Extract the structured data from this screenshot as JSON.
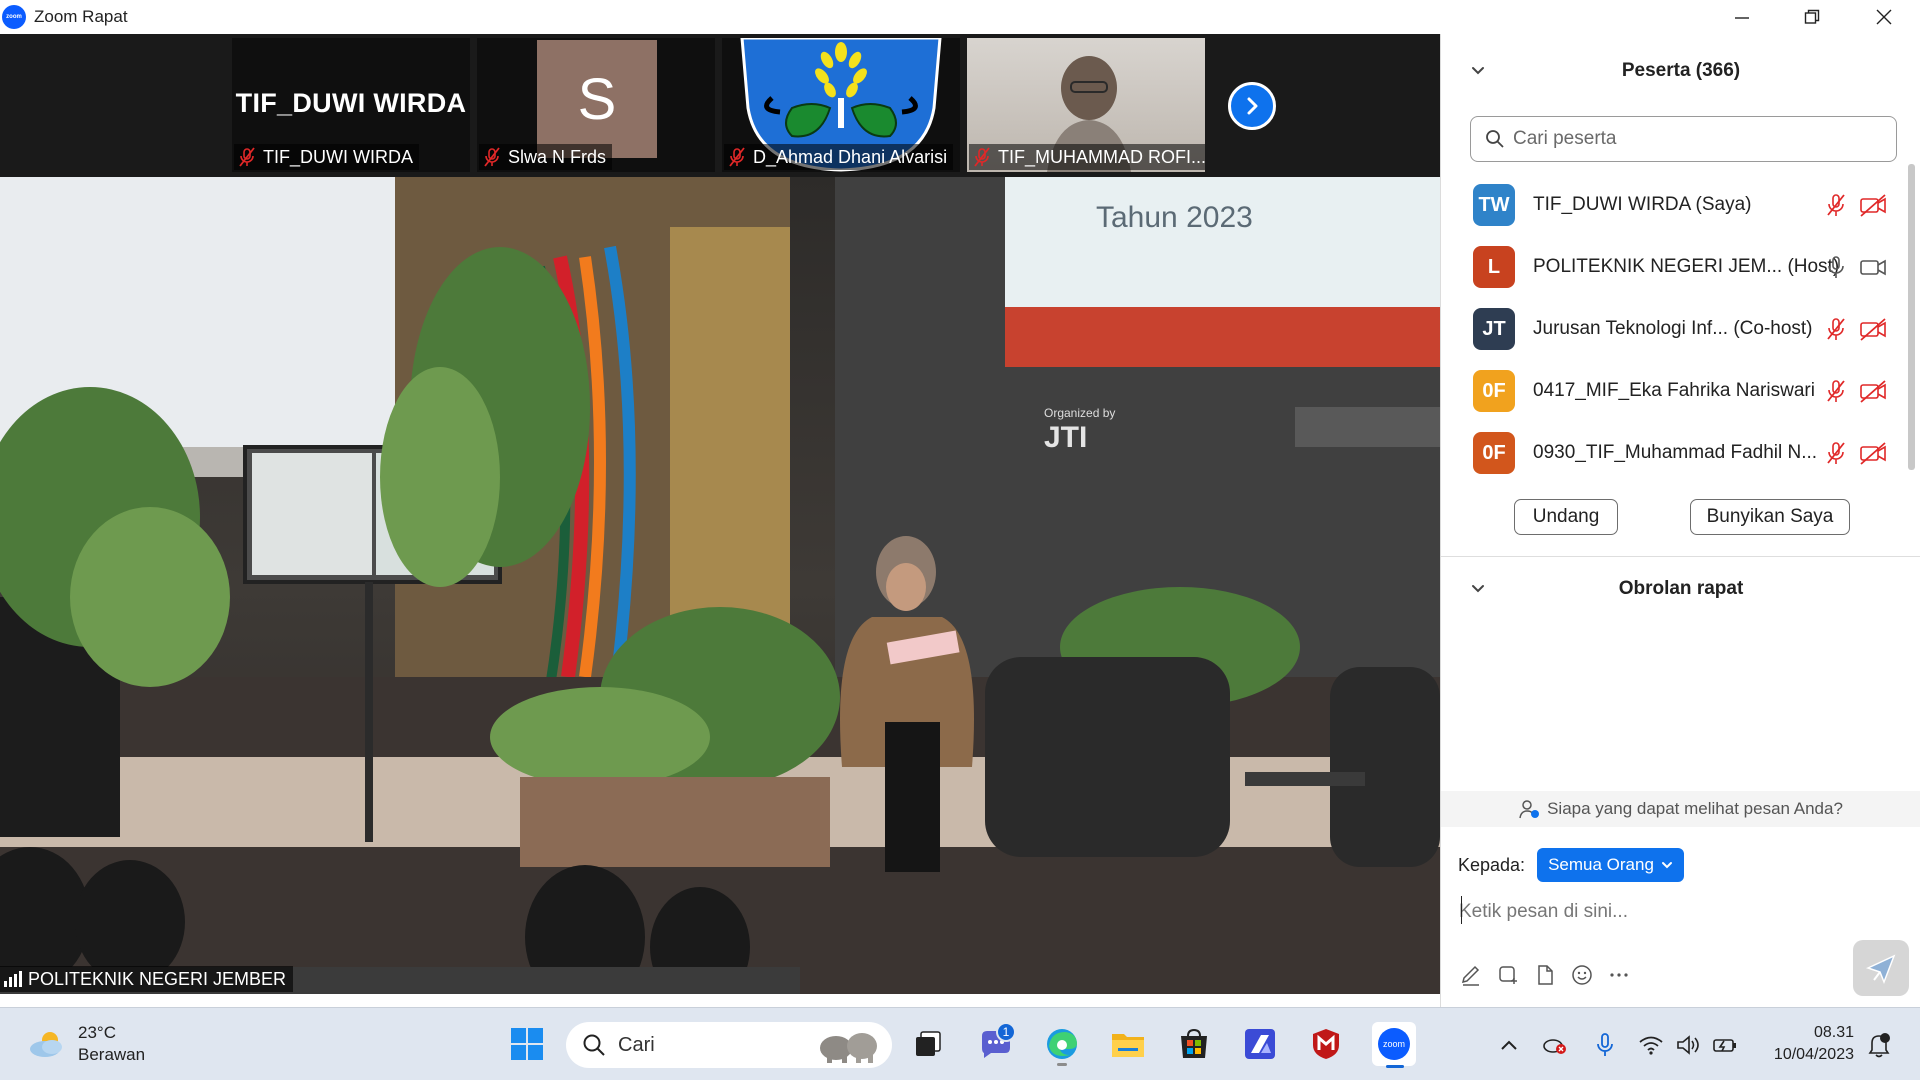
{
  "window": {
    "title": "Zoom Rapat",
    "app_logo_text": "zoom"
  },
  "video": {
    "thumbnails": [
      {
        "display_text": "TIF_DUWI WIRDA",
        "name": "TIF_DUWI WIRDA"
      },
      {
        "avatar_letter": "S",
        "name": "Slwa N Frds"
      },
      {
        "name": "D_Ahmad Dhani Alvarisi"
      },
      {
        "name": "TIF_MUHAMMAD ROFI..."
      }
    ],
    "main_speaker": "POLITEKNIK NEGERI JEMBER",
    "stage_slide": {
      "year_text": "Tahun 2023",
      "organized_by": "Organized by",
      "logo_text": "JTI"
    }
  },
  "participants": {
    "header": "Peserta (366)",
    "search_placeholder": "Cari peserta",
    "list": [
      {
        "initials": "TW",
        "color": "#2f83c9",
        "name": "TIF_DUWI WIRDA (Saya)",
        "muted": true,
        "video_off": true
      },
      {
        "initials": "L",
        "color": "#c8421f",
        "name": "POLITEKNIK NEGERI JEM... (Host)",
        "muted": false,
        "video_off": false
      },
      {
        "initials": "JT",
        "color": "#2e3d52",
        "name": "Jurusan Teknologi Inf...  (Co-host)",
        "muted": true,
        "video_off": true
      },
      {
        "initials": "0F",
        "color": "#f1a21e",
        "name": "0417_MIF_Eka Fahrika Nariswari",
        "muted": true,
        "video_off": true
      },
      {
        "initials": "0F",
        "color": "#d2561c",
        "name": "0930_TIF_Muhammad Fadhil N...",
        "muted": true,
        "video_off": true
      }
    ],
    "invite_label": "Undang",
    "unmute_label": "Bunyikan Saya"
  },
  "chat": {
    "header": "Obrolan rapat",
    "who_can_see": "Siapa yang dapat melihat pesan Anda?",
    "to_label": "Kepada:",
    "recipient": "Semua Orang",
    "input_placeholder": "Ketik pesan di sini...",
    "tools": [
      "format-icon",
      "screenshot-icon",
      "file-icon",
      "emoji-icon",
      "more-icon"
    ]
  },
  "taskbar": {
    "weather_temp": "23°C",
    "weather_desc": "Berawan",
    "search_text": "Cari",
    "chat_badge": "1",
    "time": "08.31",
    "date": "10/04/2023"
  },
  "colors": {
    "zoom_blue": "#0e72ed",
    "muted_red": "#e02828"
  }
}
